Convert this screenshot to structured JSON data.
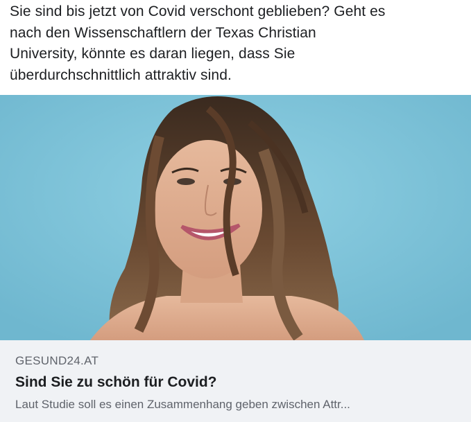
{
  "post": {
    "text": "Sie sind bis jetzt von Covid verschont geblieben? Geht es\nnach den Wissenschaftlern der Texas Christian\nUniversity, könnte es daran liegen, dass Sie\nüberdurchschnittlich attraktiv sind."
  },
  "image": {
    "subject": "smiling woman with long wavy brown hair",
    "background_color": "#7ec3d9"
  },
  "link_preview": {
    "domain": "GESUND24.AT",
    "title": "Sind Sie zu schön für Covid?",
    "description": "Laut Studie soll es einen Zusammenhang geben zwischen Attr..."
  }
}
